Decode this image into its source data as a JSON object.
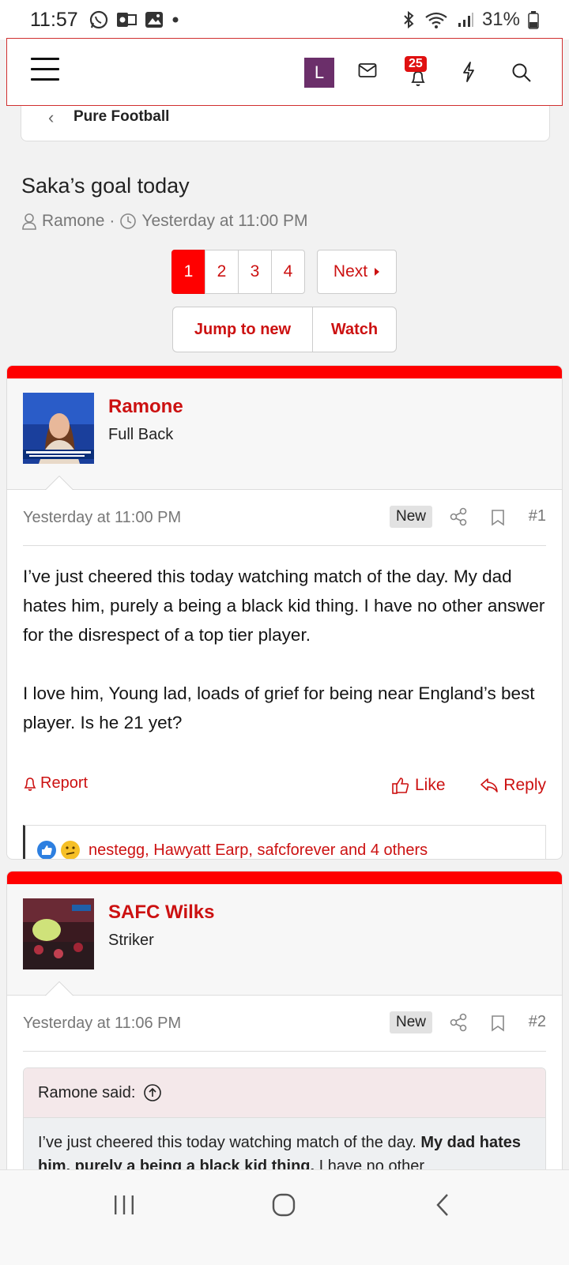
{
  "status_bar": {
    "time": "11:57",
    "battery": "31%"
  },
  "top_nav": {
    "avatar_letter": "L",
    "alerts_count": "25"
  },
  "breadcrumb": {
    "label": "Pure Football"
  },
  "thread": {
    "title": "Saka’s goal today",
    "author": "Ramone",
    "separator": "·",
    "date": "Yesterday at 11:00 PM"
  },
  "pagination": {
    "pages": [
      "1",
      "2",
      "3",
      "4"
    ],
    "current": "1",
    "next_label": "Next"
  },
  "thread_actions": {
    "jump_label": "Jump to new",
    "watch_label": "Watch"
  },
  "posts": [
    {
      "username": "Ramone",
      "user_title": "Full Back",
      "date": "Yesterday at 11:00 PM",
      "new_label": "New",
      "number": "#1",
      "paragraphs": [
        "I’ve just cheered this today watching match of the day. My dad hates him, purely a being a black kid thing. I have no other answer for the disrespect of a top tier player.",
        "I love him, Young lad, loads of grief for being near England’s best player. Is he 21 yet?"
      ],
      "report_label": "Report",
      "like_label": "Like",
      "reply_label": "Reply",
      "reactions_text": "nestegg, Hawyatt Earp, safcforever and 4 others"
    },
    {
      "username": "SAFC Wilks",
      "user_title": "Striker",
      "date": "Yesterday at 11:06 PM",
      "new_label": "New",
      "number": "#2",
      "quote_author": "Ramone said:",
      "quote_text_a": "I’ve just cheered this today watching match of the day. ",
      "quote_text_bold": "My dad hates him, purely a being a black kid thing.",
      "quote_text_b": " I have no other"
    }
  ],
  "colors": {
    "accent": "#cc1111",
    "bar": "#ff0000",
    "avatar_bg": "#6b2f6a"
  }
}
